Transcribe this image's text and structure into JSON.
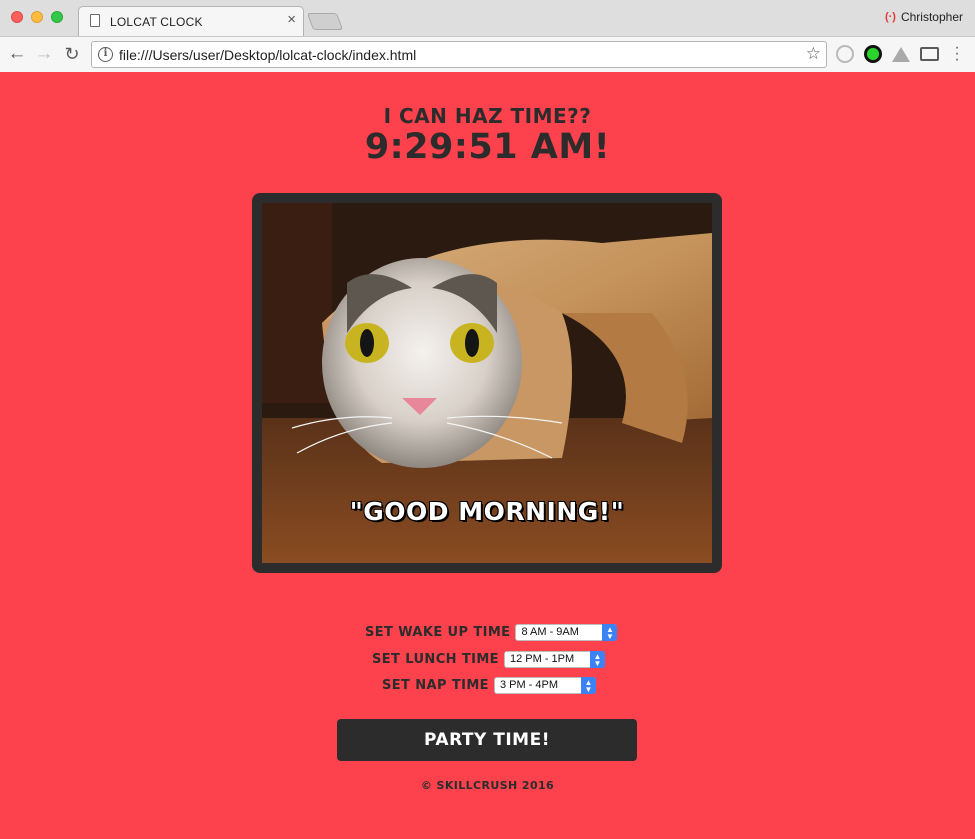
{
  "browser": {
    "tab_title": "LOLCAT CLOCK",
    "tab_close": "×",
    "profile_name": "Christopher",
    "url": "file:///Users/user/Desktop/lolcat-clock/index.html",
    "icons": [
      "back-arrow-icon",
      "forward-arrow-icon",
      "reload-icon",
      "info-icon",
      "star-icon",
      "extension-icon",
      "cast-icon",
      "menu-icon"
    ]
  },
  "page": {
    "heading": "I CAN HAZ TIME??",
    "clock": "9:29:51 AM!",
    "image_caption": "\"GOOD MORNING!\"",
    "controls": {
      "wake": {
        "label": "SET WAKE UP TIME",
        "selected": "8 AM - 9AM"
      },
      "lunch": {
        "label": "SET LUNCH TIME",
        "selected": "12 PM - 1PM"
      },
      "nap": {
        "label": "SET NAP TIME",
        "selected": "3 PM - 4PM"
      }
    },
    "party_button": "PARTY TIME!",
    "footer": "© SKILLCRUSH 2016"
  },
  "colors": {
    "background": "#fd414d",
    "dark": "#2c2c2c",
    "select_arrow": "#3b82f6"
  }
}
